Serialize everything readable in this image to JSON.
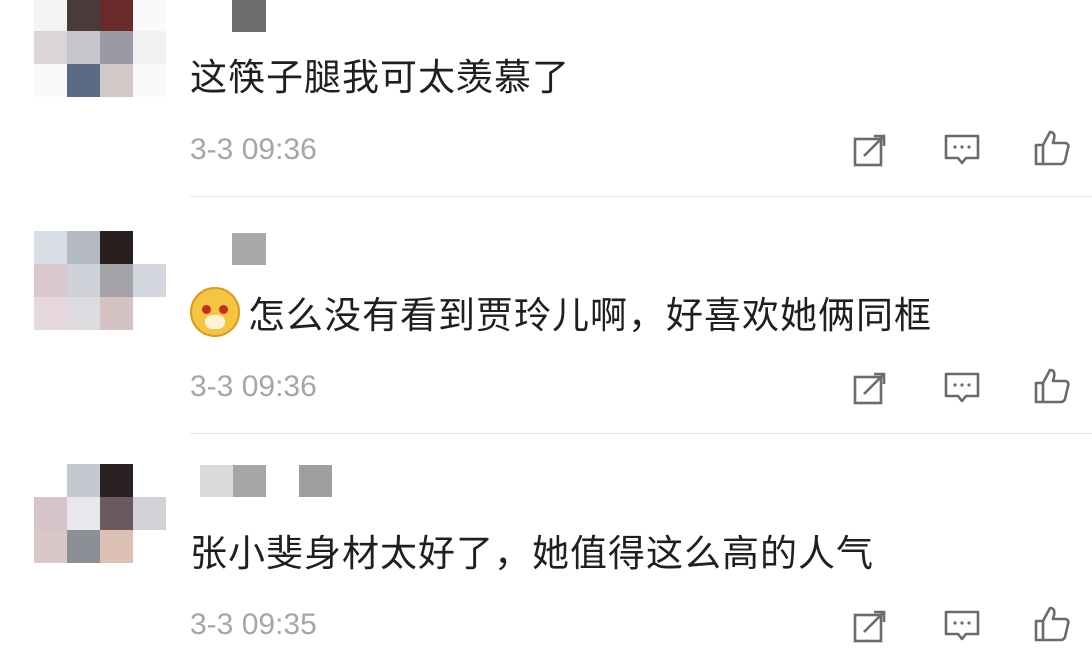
{
  "comments": [
    {
      "text": "这筷子腿我可太羡慕了",
      "time": "3-3 09:36",
      "has_emoji": false,
      "avatar_colors": [
        "#f4f4f4",
        "#4a3a3a",
        "#6b2a2a",
        "#fafafa",
        "#d9d5d8",
        "#c8c6cc",
        "#9a9aa6",
        "#f2f2f2",
        "#fafafa",
        "#5a6b86",
        "#d3c8c8",
        "#fafafa"
      ],
      "name_blocks": [
        "#6e6e6e"
      ]
    },
    {
      "text": "怎么没有看到贾玲儿啊，好喜欢她俩同框",
      "time": "3-3 09:36",
      "has_emoji": true,
      "avatar_colors": [
        "#d8dce3",
        "#b5bac4",
        "#2a1f1f",
        "#ffffff",
        "#dbc8cc",
        "#cfd1d8",
        "#a4a4a8",
        "#d4d6de",
        "#e6d8db",
        "#dedbe0",
        "#d5c3c4",
        "#ffffff"
      ],
      "name_blocks": [
        "#a9a9a9"
      ]
    },
    {
      "text": "张小斐身材太好了，她值得这么高的人气",
      "time": "3-3 09:35",
      "has_emoji": false,
      "avatar_colors": [
        "#ffffff",
        "#c6c8d0",
        "#2a2222",
        "#ffffff",
        "#d5c4c8",
        "#e8e8ec",
        "#6a5a60",
        "#d2d2d8",
        "#d8c8c8",
        "#8d8f96",
        "#dcc1b4",
        "#ffffff"
      ],
      "name_blocks": [
        "#dadada",
        "#a6a6a6",
        "#ffffff",
        "#9f9f9f"
      ]
    }
  ],
  "actions": {
    "repost_icon": "repost-icon",
    "comment_icon": "comment-icon",
    "like_icon": "thumbs-up-icon"
  },
  "colors": {
    "text": "#1f1f1f",
    "time": "#a6a6a6",
    "icon": "#6b6b6b",
    "divider": "#e8e8e8"
  }
}
